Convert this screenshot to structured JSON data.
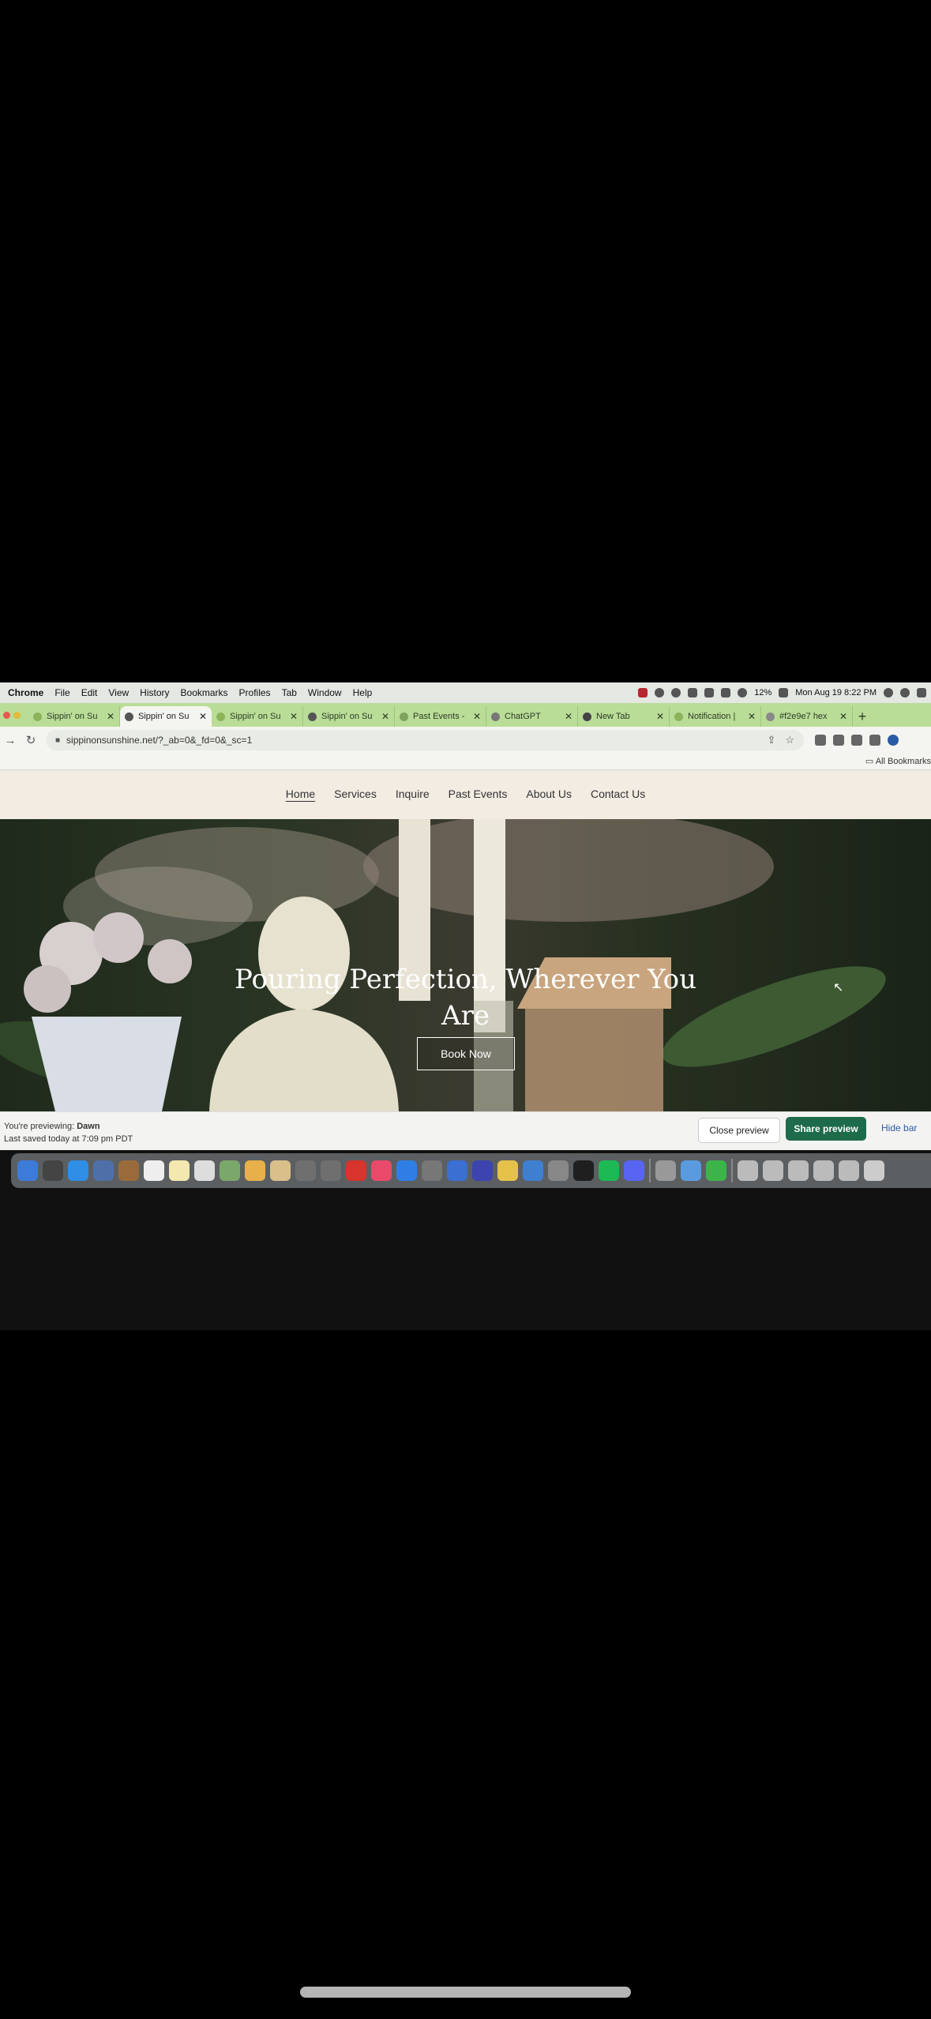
{
  "menubar": {
    "items": [
      "Chrome",
      "File",
      "Edit",
      "View",
      "History",
      "Bookmarks",
      "Profiles",
      "Tab",
      "Window",
      "Help"
    ],
    "battery": "12%",
    "clock": "Mon Aug 19  8:22 PM"
  },
  "tabs": [
    {
      "label": "Sippin' on Su",
      "active": false
    },
    {
      "label": "Sippin' on Su",
      "active": true
    },
    {
      "label": "Sippin' on Su",
      "active": false
    },
    {
      "label": "Sippin' on Su",
      "active": false
    },
    {
      "label": "Past Events -",
      "active": false
    },
    {
      "label": "ChatGPT",
      "active": false
    },
    {
      "label": "New Tab",
      "active": false
    },
    {
      "label": "Notification |",
      "active": false
    },
    {
      "label": "#f2e9e7 hex",
      "active": false
    }
  ],
  "toolbar": {
    "url": "sippinonsunshine.net/?_ab=0&_fd=0&_sc=1"
  },
  "bookmarks": {
    "all_label": "All Bookmarks"
  },
  "site": {
    "nav": [
      "Home",
      "Services",
      "Inquire",
      "Past Events",
      "About Us",
      "Contact Us"
    ],
    "hero_title": "Pouring Perfection, Wherever You Are",
    "book_button": "Book Now"
  },
  "preview": {
    "previewing_prefix": "You're previewing: ",
    "theme_name": "Dawn",
    "saved": "Last saved today at 7:09 pm PDT",
    "close_label": "Close preview",
    "share_label": "Share preview",
    "hide_label": "Hide bar"
  },
  "colors": {
    "tabstrip": "#b9dd97",
    "share_button": "#1e6b4b",
    "site_header": "#f2ece3"
  }
}
